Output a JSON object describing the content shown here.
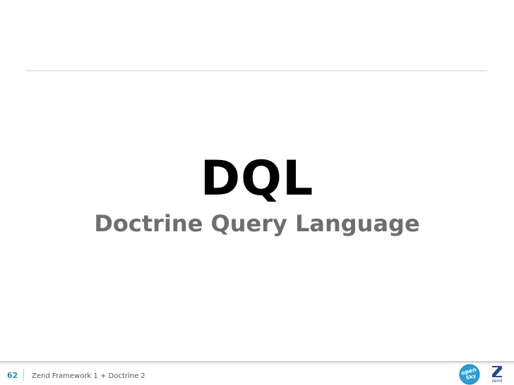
{
  "slide": {
    "title": "DQL",
    "subtitle": "Doctrine Query Language"
  },
  "footer": {
    "page_number": "62",
    "presentation_title": "Zend Framework 1 + Doctrine 2",
    "logo_opensky_line1": "open",
    "logo_opensky_line2": "Sky",
    "logo_zend_text": "zend"
  },
  "colors": {
    "title": "#000000",
    "subtitle": "#6e6e6e",
    "page_number": "#2a8bb5",
    "accent_blue": "#2a9fd6"
  }
}
